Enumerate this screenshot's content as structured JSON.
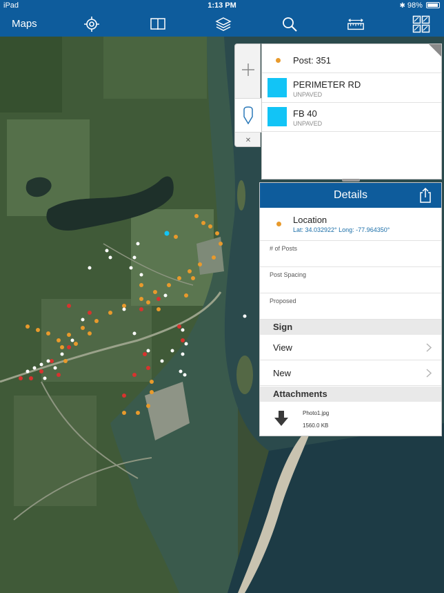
{
  "status_bar": {
    "device": "iPad",
    "time": "1:13 PM",
    "battery": "98%"
  },
  "toolbar": {
    "title": "Maps",
    "icons": [
      "locate-icon",
      "bookmarks-icon",
      "layers-icon",
      "search-icon",
      "measure-icon",
      "basemap-gallery-icon"
    ]
  },
  "map_tools": [
    "zoom-in-icon",
    "sketch-marker-icon",
    "close-icon"
  ],
  "results": [
    {
      "title": "Post: 351",
      "subtitle": "",
      "symbol": "orange-dot"
    },
    {
      "title": "PERIMETER RD",
      "subtitle": "UNPAVED",
      "symbol": "blue-square"
    },
    {
      "title": "FB 40",
      "subtitle": "UNPAVED",
      "symbol": "blue-square"
    }
  ],
  "details": {
    "title": "Details",
    "location": {
      "label": "Location",
      "coords": "Lat: 34.032922° Long: -77.964350°"
    },
    "fields": [
      "# of Posts",
      "Post Spacing",
      "Proposed"
    ],
    "sign": {
      "header": "Sign",
      "items": [
        "View",
        "New"
      ]
    },
    "attachments": {
      "header": "Attachments",
      "file_name": "Photo1.jpg",
      "file_size": "1560.0 KB"
    }
  },
  "colors": {
    "toolbar": "#0e5c9c",
    "swatch": "#12c4f6",
    "post_marker": "#e89a2c",
    "red_marker": "#d7332e",
    "white_marker": "#ffffff"
  }
}
